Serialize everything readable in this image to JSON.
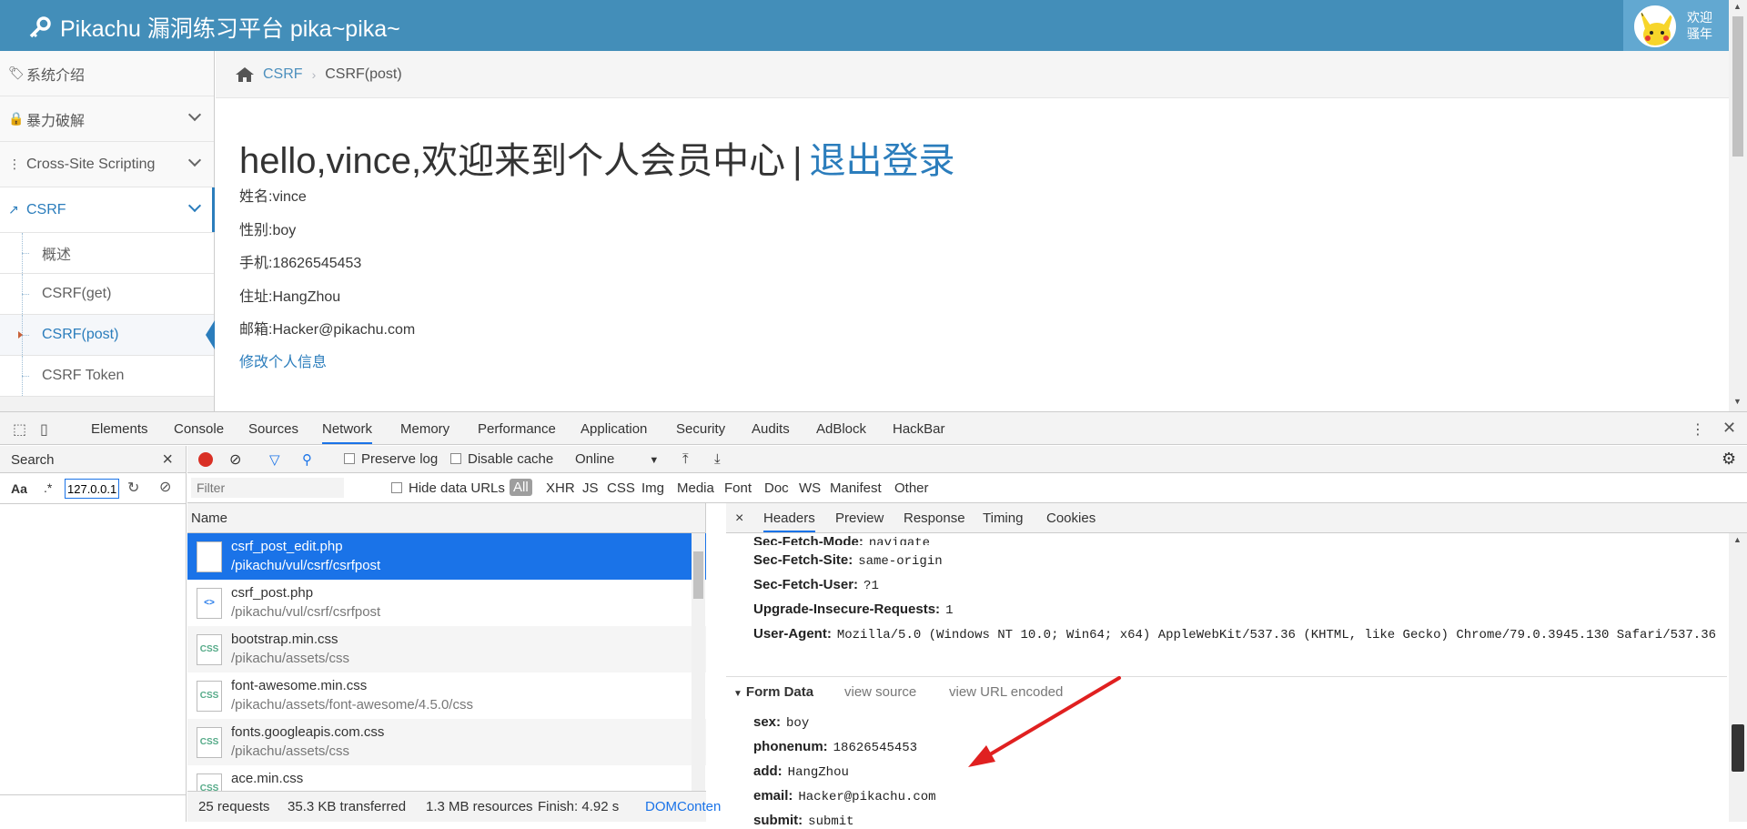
{
  "navbar": {
    "brand": "Pikachu 漏洞练习平台 pika~pika~",
    "welcome_line1": "欢迎",
    "welcome_line2": "骚年"
  },
  "sidebar": {
    "items": [
      {
        "label": "系统介绍",
        "icon": "tags-icon"
      },
      {
        "label": "暴力破解",
        "icon": "lock-icon"
      },
      {
        "label": "Cross-Site Scripting",
        "icon": "sitemap-icon"
      },
      {
        "label": "CSRF",
        "icon": "share-icon"
      }
    ],
    "csrf_sub": [
      "概述",
      "CSRF(get)",
      "CSRF(post)",
      "CSRF Token"
    ]
  },
  "breadcrumb": {
    "parent": "CSRF",
    "current": "CSRF(post)"
  },
  "main": {
    "greeting": "hello,vince,欢迎来到个人会员中心",
    "separator": "|",
    "logout": "退出登录",
    "name": "姓名:vince",
    "sex": "性别:boy",
    "phone": "手机:18626545453",
    "address": "住址:HangZhou",
    "email": "邮箱:Hacker@pikachu.com",
    "edit_link": "修改个人信息"
  },
  "devtools": {
    "tabs": [
      "Elements",
      "Console",
      "Sources",
      "Network",
      "Memory",
      "Performance",
      "Application",
      "Security",
      "Audits",
      "AdBlock",
      "HackBar"
    ],
    "active_tab": "Network",
    "search": {
      "label": "Search",
      "case": "Aa",
      "regex": ".*",
      "value": "127.0.0.1"
    },
    "toolbar": {
      "preserve_log": "Preserve log",
      "disable_cache": "Disable cache",
      "throttle": "Online"
    },
    "filter": {
      "placeholder": "Filter",
      "hide_data_urls": "Hide data URLs",
      "types": [
        "All",
        "XHR",
        "JS",
        "CSS",
        "Img",
        "Media",
        "Font",
        "Doc",
        "WS",
        "Manifest",
        "Other"
      ]
    },
    "requests_header": "Name",
    "requests": [
      {
        "name": "csrf_post_edit.php",
        "path": "/pikachu/vul/csrf/csrfpost",
        "type": "doc"
      },
      {
        "name": "csrf_post.php",
        "path": "/pikachu/vul/csrf/csrfpost",
        "type": "code"
      },
      {
        "name": "bootstrap.min.css",
        "path": "/pikachu/assets/css",
        "type": "css"
      },
      {
        "name": "font-awesome.min.css",
        "path": "/pikachu/assets/font-awesome/4.5.0/css",
        "type": "css"
      },
      {
        "name": "fonts.googleapis.com.css",
        "path": "/pikachu/assets/css",
        "type": "css"
      },
      {
        "name": "ace.min.css",
        "path": "",
        "type": "css"
      }
    ],
    "status": {
      "requests": "25 requests",
      "transferred": "35.3 KB transferred",
      "resources": "1.3 MB resources",
      "finish": "Finish: 4.92 s",
      "dom": "DOMConten"
    },
    "detail_tabs": [
      "Headers",
      "Preview",
      "Response",
      "Timing",
      "Cookies"
    ],
    "headers": [
      {
        "key": "Sec-Fetch-Mode:",
        "value": "navigate"
      },
      {
        "key": "Sec-Fetch-Site:",
        "value": "same-origin"
      },
      {
        "key": "Sec-Fetch-User:",
        "value": "?1"
      },
      {
        "key": "Upgrade-Insecure-Requests:",
        "value": "1"
      },
      {
        "key": "User-Agent:",
        "value": "Mozilla/5.0 (Windows NT 10.0; Win64; x64) AppleWebKit/537.36 (KHTML, like Gecko) Chrome/79.0.3945.130 Safari/537.36"
      }
    ],
    "form_data": {
      "title": "Form Data",
      "view_source": "view source",
      "view_url_encoded": "view URL encoded",
      "fields": [
        {
          "key": "sex:",
          "value": "boy"
        },
        {
          "key": "phonenum:",
          "value": "18626545453"
        },
        {
          "key": "add:",
          "value": "HangZhou"
        },
        {
          "key": "email:",
          "value": "Hacker@pikachu.com"
        },
        {
          "key": "submit:",
          "value": "submit"
        }
      ]
    }
  },
  "colors": {
    "navbar": "#438eb9",
    "accent": "#2b7dbc",
    "selected_request": "#1a73e8",
    "annotation_arrow": "#e02020"
  }
}
